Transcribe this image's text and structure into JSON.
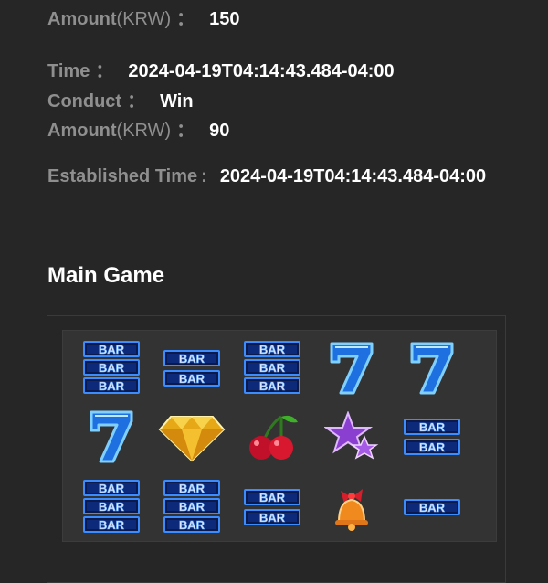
{
  "entries": {
    "amount1": {
      "label": "Amount",
      "unit": "(KRW)",
      "sep": "：",
      "value": "150"
    },
    "time": {
      "label": "Time",
      "sep": "：",
      "value": "2024-04-19T04:14:43.484-04:00"
    },
    "conduct": {
      "label": "Conduct",
      "sep": "：",
      "value": "Win"
    },
    "amount2": {
      "label": "Amount",
      "unit": "(KRW)",
      "sep": "：",
      "value": "90"
    },
    "established": {
      "label": "Established Time",
      "sep": ":",
      "value": "2024-04-19T04:14:43.484-04:00"
    }
  },
  "main_game": {
    "title": "Main Game",
    "symbol_text": "BAR",
    "grid": [
      [
        "triple-bar-icon",
        "double-bar-icon",
        "triple-bar-icon",
        "seven-icon",
        "seven-icon"
      ],
      [
        "seven-icon",
        "diamond-icon",
        "cherry-icon",
        "star-icon",
        "double-bar-icon"
      ],
      [
        "triple-bar-icon",
        "triple-bar-icon",
        "double-bar-icon",
        "bell-icon",
        "single-bar-icon"
      ]
    ]
  },
  "colors": {
    "background": "#262626",
    "label": "#8f8f8f",
    "value": "#ffffff",
    "board": "#333333",
    "bar_blue": "#1f6fd6",
    "seven_blue": "#1e88ff"
  }
}
